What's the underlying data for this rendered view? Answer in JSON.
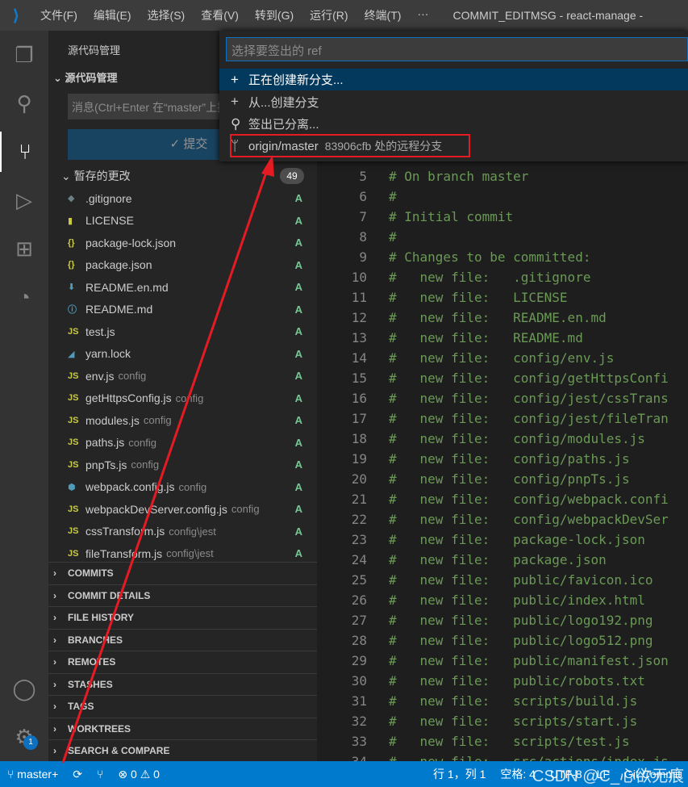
{
  "titlebar": {
    "menus": [
      "文件(F)",
      "编辑(E)",
      "选择(S)",
      "查看(V)",
      "转到(G)",
      "运行(R)",
      "终端(T)",
      "···"
    ],
    "title": "COMMIT_EDITMSG - react-manage -"
  },
  "activity": {
    "badge": "1"
  },
  "sidebar": {
    "title": "源代码管理",
    "section": "源代码管理",
    "message_placeholder": "消息(Ctrl+Enter 在“master”上提交)",
    "commit_label": "✓ 提交",
    "staged_label": "暂存的更改",
    "staged_count": "49",
    "files": [
      {
        "name": ".gitignore",
        "dir": "",
        "icon": "◆",
        "color": "#6d8086",
        "status": "A"
      },
      {
        "name": "LICENSE",
        "dir": "",
        "icon": "▮",
        "color": "#cbcb41",
        "status": "A"
      },
      {
        "name": "package-lock.json",
        "dir": "",
        "icon": "{}",
        "color": "#cbcb41",
        "status": "A"
      },
      {
        "name": "package.json",
        "dir": "",
        "icon": "{}",
        "color": "#cbcb41",
        "status": "A"
      },
      {
        "name": "README.en.md",
        "dir": "",
        "icon": "⬇",
        "color": "#519aba",
        "status": "A"
      },
      {
        "name": "README.md",
        "dir": "",
        "icon": "ⓘ",
        "color": "#519aba",
        "status": "A"
      },
      {
        "name": "test.js",
        "dir": "",
        "icon": "JS",
        "color": "#cbcb41",
        "status": "A"
      },
      {
        "name": "yarn.lock",
        "dir": "",
        "icon": "◢",
        "color": "#519aba",
        "status": "A"
      },
      {
        "name": "env.js",
        "dir": "config",
        "icon": "JS",
        "color": "#cbcb41",
        "status": "A"
      },
      {
        "name": "getHttpsConfig.js",
        "dir": "config",
        "icon": "JS",
        "color": "#cbcb41",
        "status": "A"
      },
      {
        "name": "modules.js",
        "dir": "config",
        "icon": "JS",
        "color": "#cbcb41",
        "status": "A"
      },
      {
        "name": "paths.js",
        "dir": "config",
        "icon": "JS",
        "color": "#cbcb41",
        "status": "A"
      },
      {
        "name": "pnpTs.js",
        "dir": "config",
        "icon": "JS",
        "color": "#cbcb41",
        "status": "A"
      },
      {
        "name": "webpack.config.js",
        "dir": "config",
        "icon": "⬢",
        "color": "#519aba",
        "status": "A"
      },
      {
        "name": "webpackDevServer.config.js",
        "dir": "config",
        "icon": "JS",
        "color": "#cbcb41",
        "status": "A"
      },
      {
        "name": "cssTransform.js",
        "dir": "config\\jest",
        "icon": "JS",
        "color": "#cbcb41",
        "status": "A"
      },
      {
        "name": "fileTransform.js",
        "dir": "config\\jest",
        "icon": "JS",
        "color": "#cbcb41",
        "status": "A"
      }
    ],
    "panels": [
      "COMMITS",
      "COMMIT DETAILS",
      "FILE HISTORY",
      "BRANCHES",
      "REMOTES",
      "STASHES",
      "TAGS",
      "WORKTREES",
      "SEARCH & COMPARE"
    ]
  },
  "quickpick": {
    "placeholder": "选择要签出的 ref",
    "items": [
      {
        "icon": "+",
        "label": "正在创建新分支...",
        "desc": "",
        "selected": true
      },
      {
        "icon": "+",
        "label": "从...创建分支",
        "desc": "",
        "selected": false
      },
      {
        "icon": "⚲",
        "label": "签出已分离...",
        "desc": "",
        "selected": false
      },
      {
        "icon": "ᛘ",
        "label": "origin/master",
        "desc": "83906cfb 处的远程分支",
        "selected": false
      }
    ]
  },
  "editor": {
    "lines": [
      {
        "n": "5",
        "t": "# On branch master"
      },
      {
        "n": "6",
        "t": "#"
      },
      {
        "n": "7",
        "t": "# Initial commit"
      },
      {
        "n": "8",
        "t": "#"
      },
      {
        "n": "9",
        "t": "# Changes to be committed:"
      },
      {
        "n": "10",
        "t": "#   new file:   .gitignore"
      },
      {
        "n": "11",
        "t": "#   new file:   LICENSE"
      },
      {
        "n": "12",
        "t": "#   new file:   README.en.md"
      },
      {
        "n": "13",
        "t": "#   new file:   README.md"
      },
      {
        "n": "14",
        "t": "#   new file:   config/env.js"
      },
      {
        "n": "15",
        "t": "#   new file:   config/getHttpsConfi"
      },
      {
        "n": "16",
        "t": "#   new file:   config/jest/cssTrans"
      },
      {
        "n": "17",
        "t": "#   new file:   config/jest/fileTran"
      },
      {
        "n": "18",
        "t": "#   new file:   config/modules.js"
      },
      {
        "n": "19",
        "t": "#   new file:   config/paths.js"
      },
      {
        "n": "20",
        "t": "#   new file:   config/pnpTs.js"
      },
      {
        "n": "21",
        "t": "#   new file:   config/webpack.confi"
      },
      {
        "n": "22",
        "t": "#   new file:   config/webpackDevSer"
      },
      {
        "n": "23",
        "t": "#   new file:   package-lock.json"
      },
      {
        "n": "24",
        "t": "#   new file:   package.json"
      },
      {
        "n": "25",
        "t": "#   new file:   public/favicon.ico"
      },
      {
        "n": "26",
        "t": "#   new file:   public/index.html"
      },
      {
        "n": "27",
        "t": "#   new file:   public/logo192.png"
      },
      {
        "n": "28",
        "t": "#   new file:   public/logo512.png"
      },
      {
        "n": "29",
        "t": "#   new file:   public/manifest.json"
      },
      {
        "n": "30",
        "t": "#   new file:   public/robots.txt"
      },
      {
        "n": "31",
        "t": "#   new file:   scripts/build.js"
      },
      {
        "n": "32",
        "t": "#   new file:   scripts/start.js"
      },
      {
        "n": "33",
        "t": "#   new file:   scripts/test.js"
      },
      {
        "n": "34",
        "t": "#   new file:   src/actions/index.js"
      }
    ]
  },
  "statusbar": {
    "branch": "master+",
    "sync": "⟳",
    "publish": "⑂",
    "problems": "⊗ 0 ⚠ 0",
    "position": "行 1，列 1",
    "spaces": "空格: 4",
    "encoding": "UTF-8",
    "eol": "LF",
    "language": "Git Commit"
  },
  "watermark": "CSDN @C_心欲无痕",
  "colors": {
    "accent": "#007acc",
    "highlight": "#e51b24"
  }
}
